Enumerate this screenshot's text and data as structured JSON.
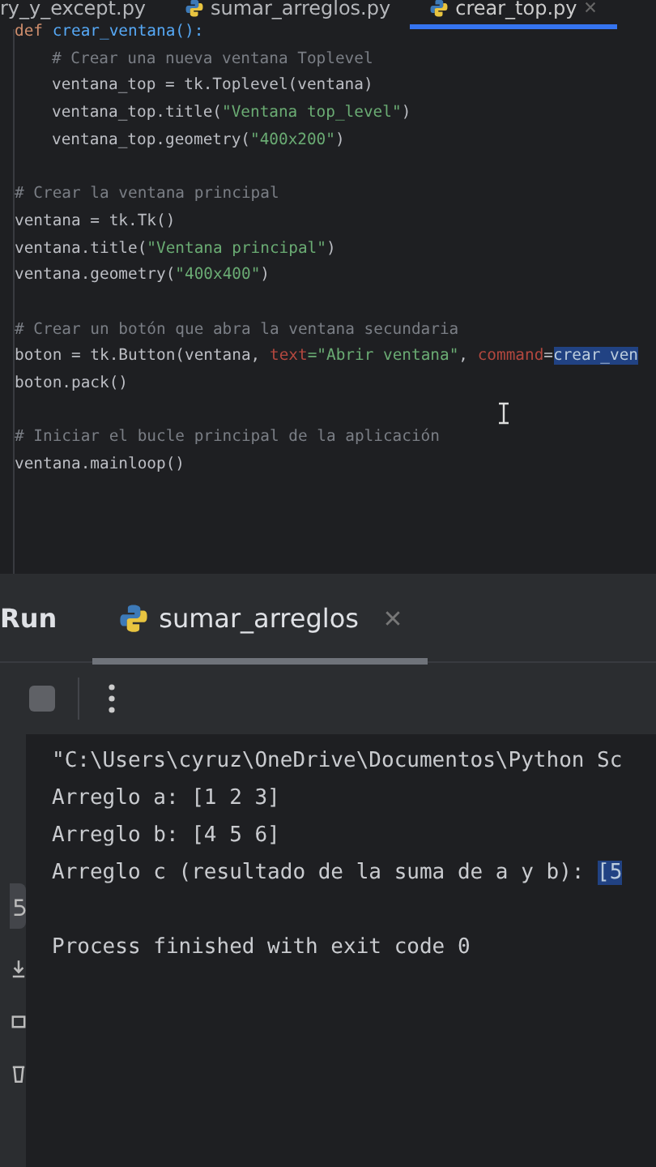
{
  "editor_tabs": [
    {
      "label": "ry_y_except.py",
      "python_icon": false,
      "selected": false,
      "closable": false
    },
    {
      "label": "sumar_arreglos.py",
      "python_icon": true,
      "selected": false,
      "closable": false
    },
    {
      "label": "crear_top.py",
      "python_icon": true,
      "selected": true,
      "closable": true
    }
  ],
  "code_lines": [
    {
      "kind": "code",
      "indented": false,
      "tokens": [
        {
          "kind": "keyword",
          "text": "def "
        },
        {
          "kind": "func",
          "text": "crear_ventana():"
        }
      ]
    },
    {
      "kind": "code",
      "indented": true,
      "tokens": [
        {
          "kind": "comment",
          "text": "# Crear una nueva ventana Toplevel"
        }
      ]
    },
    {
      "kind": "code",
      "indented": true,
      "tokens": [
        {
          "kind": "plain",
          "text": "ventana_top = tk.Toplevel(ventana)"
        }
      ]
    },
    {
      "kind": "code",
      "indented": true,
      "tokens": [
        {
          "kind": "plain",
          "text": "ventana_top.title("
        },
        {
          "kind": "string",
          "text": "\"Ventana top_level\""
        },
        {
          "kind": "plain",
          "text": ")"
        }
      ]
    },
    {
      "kind": "code",
      "indented": true,
      "tokens": [
        {
          "kind": "plain",
          "text": "ventana_top.geometry("
        },
        {
          "kind": "string",
          "text": "\"400x200\""
        },
        {
          "kind": "plain",
          "text": ")"
        }
      ]
    },
    {
      "kind": "blank"
    },
    {
      "kind": "code",
      "indented": false,
      "tokens": [
        {
          "kind": "comment",
          "text": "# Crear la ventana principal"
        }
      ]
    },
    {
      "kind": "code",
      "indented": false,
      "tokens": [
        {
          "kind": "plain",
          "text": "ventana = tk.Tk()"
        }
      ]
    },
    {
      "kind": "code",
      "indented": false,
      "tokens": [
        {
          "kind": "plain",
          "text": "ventana.title("
        },
        {
          "kind": "string",
          "text": "\"Ventana principal\""
        },
        {
          "kind": "plain",
          "text": ")"
        }
      ]
    },
    {
      "kind": "code",
      "indented": false,
      "tokens": [
        {
          "kind": "plain",
          "text": "ventana.geometry("
        },
        {
          "kind": "string",
          "text": "\"400x400\""
        },
        {
          "kind": "plain",
          "text": ")"
        }
      ]
    },
    {
      "kind": "blank"
    },
    {
      "kind": "code",
      "indented": false,
      "tokens": [
        {
          "kind": "comment",
          "text": "# Crear un botón que abra la ventana secundaria"
        }
      ]
    },
    {
      "kind": "code",
      "indented": false,
      "tokens": [
        {
          "kind": "plain",
          "text": "boton = tk.Button(ventana, "
        },
        {
          "kind": "param",
          "text": "text"
        },
        {
          "kind": "string",
          "text": "=\"Abrir ventana\""
        },
        {
          "kind": "plain",
          "text": ", "
        },
        {
          "kind": "param",
          "text": "command"
        },
        {
          "kind": "plain",
          "text": "="
        },
        {
          "kind": "selected",
          "text": "crear_ven"
        }
      ]
    },
    {
      "kind": "code",
      "indented": false,
      "tokens": [
        {
          "kind": "plain",
          "text": "boton.pack()"
        }
      ]
    },
    {
      "kind": "blank"
    },
    {
      "kind": "code",
      "indented": false,
      "tokens": [
        {
          "kind": "comment",
          "text": "# Iniciar el bucle principal de la aplicación"
        }
      ]
    },
    {
      "kind": "code",
      "indented": false,
      "tokens": [
        {
          "kind": "plain",
          "text": "ventana.mainloop()"
        }
      ]
    }
  ],
  "run_panel": {
    "title": "Run",
    "tabs": [
      {
        "label": "sumar_arreglos",
        "selected": true,
        "closable": true
      }
    ]
  },
  "console_lines": [
    {
      "kind": "output",
      "tokens": [
        {
          "kind": "plain",
          "text": "\"C:\\Users\\cyruz\\OneDrive\\Documentos\\Python Sc"
        }
      ]
    },
    {
      "kind": "output",
      "tokens": [
        {
          "kind": "plain",
          "text": "Arreglo a: [1 2 3]"
        }
      ]
    },
    {
      "kind": "output",
      "tokens": [
        {
          "kind": "plain",
          "text": "Arreglo b: [4 5 6]"
        }
      ]
    },
    {
      "kind": "output",
      "tokens": [
        {
          "kind": "plain",
          "text": "Arreglo c (resultado de la suma de a y b): "
        },
        {
          "kind": "selected",
          "text": "[5"
        }
      ]
    },
    {
      "kind": "blank"
    },
    {
      "kind": "output",
      "tokens": [
        {
          "kind": "plain",
          "text": "Process finished with exit code 0"
        }
      ]
    }
  ]
}
